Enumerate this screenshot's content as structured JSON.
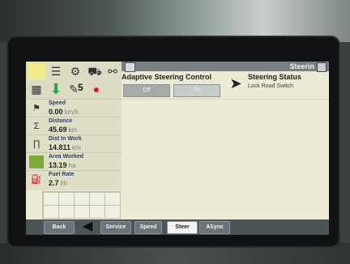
{
  "header": {
    "title": "Steerin",
    "page_badge": ""
  },
  "adaptive_steering": {
    "title": "Adaptive Steering Control",
    "off_label": "Off",
    "on_label": "On"
  },
  "steering_status": {
    "title": "Steering Status",
    "subtitle": "Lock Road Switch"
  },
  "icon_panel": {
    "badge_count": "5"
  },
  "stats": {
    "speed": {
      "label": "Speed",
      "value": "0.00",
      "unit": "km/h"
    },
    "distance": {
      "label": "Distance",
      "value": "45.69",
      "unit": "km"
    },
    "dist_in_work": {
      "label": "Dist In Work",
      "value": "14.811",
      "unit": "km"
    },
    "area_worked": {
      "label": "Area Worked",
      "value": "13.19",
      "unit": "ha"
    },
    "fuel_rate": {
      "label": "Fuel Rate",
      "value": "2.7",
      "unit": "l/h"
    }
  },
  "tabs": {
    "back": "Back",
    "service": "Service",
    "speed": "Speed",
    "steer": "Steer",
    "async": "ASync"
  }
}
